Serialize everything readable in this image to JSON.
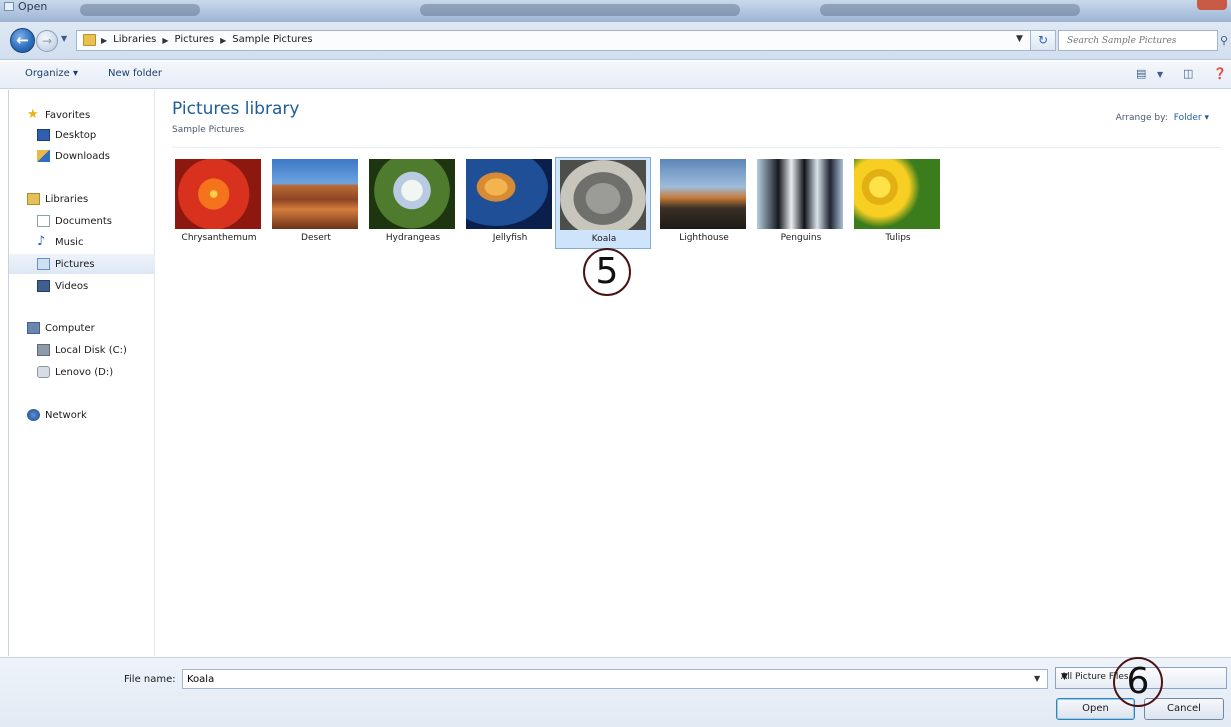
{
  "window": {
    "title": "Open"
  },
  "address": {
    "crumbs": [
      "Libraries",
      "Pictures",
      "Sample Pictures"
    ],
    "search_placeholder": "Search Sample Pictures"
  },
  "toolbar": {
    "organize_label": "Organize ▾",
    "new_folder_label": "New folder"
  },
  "nav": {
    "favorites": "Favorites",
    "desktop": "Desktop",
    "downloads": "Downloads",
    "libraries": "Libraries",
    "documents": "Documents",
    "music": "Music",
    "pictures": "Pictures",
    "videos": "Videos",
    "computer": "Computer",
    "local_disk": "Local Disk (C:)",
    "lenovo": "Lenovo (D:)",
    "network": "Network"
  },
  "content": {
    "title": "Pictures library",
    "subtitle": "Sample Pictures",
    "arrange_label": "Arrange by:",
    "arrange_value": "Folder ▾",
    "files": [
      "Chrysanthemum",
      "Desert",
      "Hydrangeas",
      "Jellyfish",
      "Koala",
      "Lighthouse",
      "Penguins",
      "Tulips"
    ],
    "selected": "Koala"
  },
  "footer": {
    "file_name_label": "File name:",
    "file_name_value": "Koala",
    "file_type_value": "All Picture Files",
    "open_label": "Open",
    "cancel_label": "Cancel"
  },
  "annotations": {
    "step5": "5",
    "step6": "6"
  },
  "colors": {
    "accent": "#1e5c9a",
    "selection": "#cde4fb",
    "callout": "#4b1414"
  }
}
